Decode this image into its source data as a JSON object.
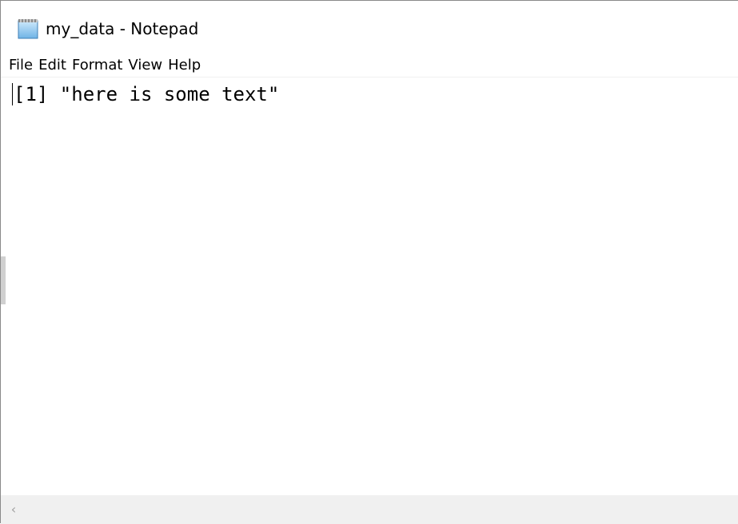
{
  "window": {
    "title": "my_data - Notepad",
    "app_icon": "notepad-icon"
  },
  "menu": {
    "items": [
      {
        "label": "File"
      },
      {
        "label": "Edit"
      },
      {
        "label": "Format"
      },
      {
        "label": "View"
      },
      {
        "label": "Help"
      }
    ]
  },
  "editor": {
    "content": "[1] \"here is some text\""
  },
  "scrollbar": {
    "left_arrow": "‹",
    "left_arrow_icon": "chevron-left-icon"
  }
}
